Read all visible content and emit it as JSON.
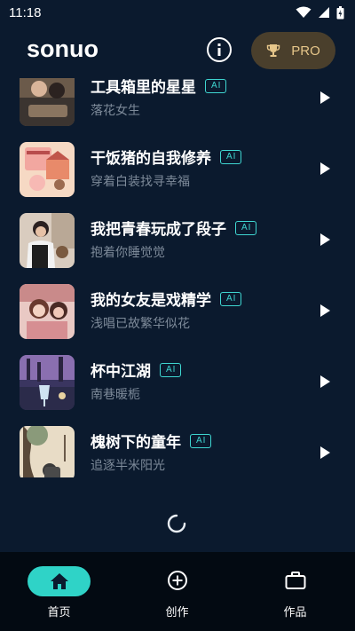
{
  "status_bar": {
    "time": "11:18"
  },
  "header": {
    "app_name": "sonuo",
    "pro_label": "PRO"
  },
  "colors": {
    "background": "#0b1a2e",
    "accent": "#3fd6d1",
    "pro_bg": "#4a3f2c",
    "pro_text": "#e6c68a"
  },
  "songs": [
    {
      "title": "工具箱里的星星",
      "subtitle": "落花女生",
      "badge": "AI"
    },
    {
      "title": "干饭猪的自我修养",
      "subtitle": "穿着白装找寻幸福",
      "badge": "AI"
    },
    {
      "title": "我把青春玩成了段子",
      "subtitle": "抱着你睡觉觉",
      "badge": "AI"
    },
    {
      "title": "我的女友是戏精学",
      "subtitle": "浅唱已故繁华似花",
      "badge": "AI"
    },
    {
      "title": "杯中江湖",
      "subtitle": "南巷暖栀",
      "badge": "AI"
    },
    {
      "title": "槐树下的童年",
      "subtitle": "追逐半米阳光",
      "badge": "AI"
    }
  ],
  "nav": {
    "tabs": [
      {
        "label": "首页",
        "icon": "home-icon",
        "active": true
      },
      {
        "label": "创作",
        "icon": "plus-circle-icon",
        "active": false
      },
      {
        "label": "作品",
        "icon": "briefcase-icon",
        "active": false
      }
    ]
  }
}
